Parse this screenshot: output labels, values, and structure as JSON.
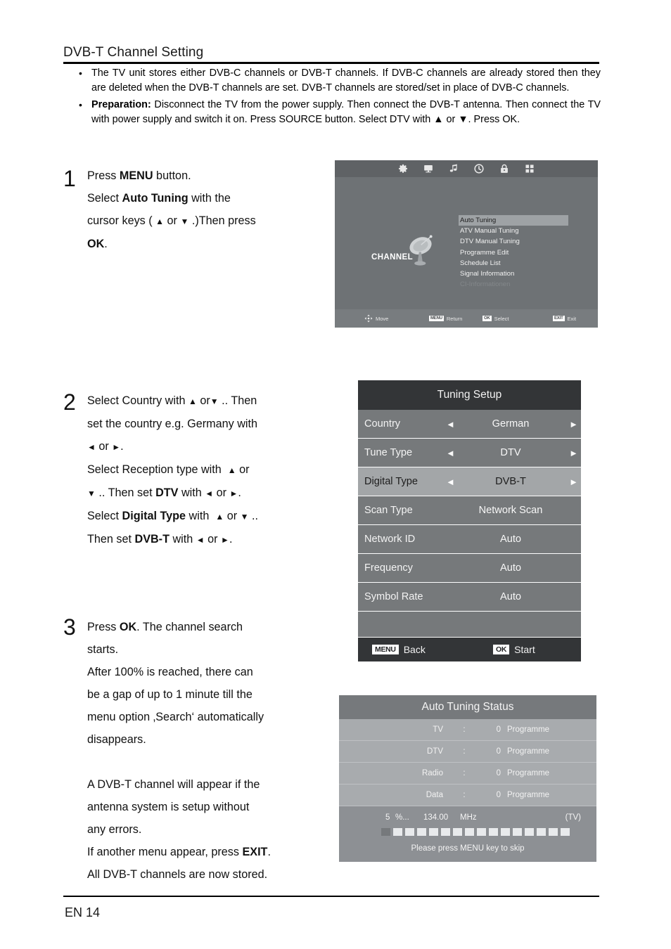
{
  "document": {
    "title": "DVB-T Channel Setting",
    "footer_page": "EN 14"
  },
  "intro": {
    "bullet_marker": "•",
    "items": [
      {
        "lead": "",
        "text": "The TV unit stores either DVB-C channels or DVB-T channels. If DVB-C channels are already stored then they are deleted when the DVB-T channels are set. DVB-T channels are stored/set in place of DVB-C channels."
      },
      {
        "lead": "Preparation:",
        "text": "Disconnect the TV from the power supply. Then connect the DVB-T antenna. Then connect the TV with power supply and switch it on. Press SOURCE button. Select DTV with ▲ or ▼. Press OK."
      }
    ]
  },
  "steps": [
    {
      "number": "1",
      "lines": [
        "Press MENU button.",
        "Select Auto Tuning with the",
        "cursor keys ( ▲ or ▼ .)Then press",
        "OK."
      ]
    },
    {
      "number": "2",
      "lines": [
        "Select Country with ▲ or ▼ .. Then",
        "set the country e.g. Germany with",
        "◄ or ►.",
        "Select Reception type with  ▲ or",
        "▼ .. Then set DTV with ◄ or ►.",
        "Select Digital Type with  ▲ or ▼ ..",
        "Then set DVB-T with ◄ or ►."
      ]
    },
    {
      "number": "3",
      "lines": [
        "Press OK. The channel search",
        "starts.",
        "After 100% is reached, there can",
        "be a gap of up to 1 minute till the",
        "menu option ‚Search‘ automatically",
        "disappears.",
        "",
        "A DVB-T channel will appear if the",
        "antenna system is setup without",
        "any errors.",
        "If another menu appear, press EXIT.",
        "All DVB-T channels are now stored."
      ]
    }
  ],
  "osd_channel": {
    "icon_bar": [
      "gear-icon",
      "monitor-icon",
      "music-note-icon",
      "clock-icon",
      "lock-icon",
      "apps-grid-icon"
    ],
    "category_label": "CHANNEL",
    "category_icon": "satellite-dish-icon",
    "menu_items": [
      {
        "label": "Auto Tuning",
        "state": "selected"
      },
      {
        "label": "ATV Manual Tuning",
        "state": "normal"
      },
      {
        "label": "DTV Manual Tuning",
        "state": "normal"
      },
      {
        "label": "Programme Edit",
        "state": "normal"
      },
      {
        "label": "Schedule List",
        "state": "normal"
      },
      {
        "label": "Signal Information",
        "state": "normal"
      },
      {
        "label": "CI-Informationen",
        "state": "disabled"
      }
    ],
    "hints": [
      {
        "key": "",
        "icon": "dpad-icon",
        "label": "Move"
      },
      {
        "key": "MENU",
        "icon": "",
        "label": "Return"
      },
      {
        "key": "OK",
        "icon": "",
        "label": "Select"
      },
      {
        "key": "EXIT",
        "icon": "",
        "label": "Exit"
      }
    ]
  },
  "osd_tuning_setup": {
    "title": "Tuning Setup",
    "rows": [
      {
        "label": "Country",
        "value": "German",
        "arrows": true,
        "highlight": false
      },
      {
        "label": "Tune Type",
        "value": "DTV",
        "arrows": true,
        "highlight": false
      },
      {
        "label": "Digital Type",
        "value": "DVB-T",
        "arrows": true,
        "highlight": true
      },
      {
        "label": "Scan Type",
        "value": "Network Scan",
        "arrows": false,
        "highlight": false
      },
      {
        "label": "Network ID",
        "value": "Auto",
        "arrows": false,
        "highlight": false
      },
      {
        "label": "Frequency",
        "value": "Auto",
        "arrows": false,
        "highlight": false
      },
      {
        "label": "Symbol Rate",
        "value": "Auto",
        "arrows": false,
        "highlight": false
      }
    ],
    "left_caret": "◄",
    "right_caret": "►",
    "footer": {
      "back_key": "MENU",
      "back_label": "Back",
      "start_key": "OK",
      "start_label": "Start"
    }
  },
  "osd_auto_tuning_status": {
    "title": "Auto Tuning Status",
    "colon": ":",
    "rows": [
      {
        "label": "TV",
        "count": "0",
        "unit": "Programme"
      },
      {
        "label": "DTV",
        "count": "0",
        "unit": "Programme"
      },
      {
        "label": "Radio",
        "count": "0",
        "unit": "Programme"
      },
      {
        "label": "Data",
        "count": "0",
        "unit": "Programme"
      }
    ],
    "progress": {
      "percent": "5",
      "percent_sign": "%...",
      "frequency": "134.00",
      "frequency_unit": "MHz",
      "mode": "(TV)",
      "segments_total": 16,
      "segments_filled": 1
    },
    "note": "Please press MENU key to skip"
  }
}
